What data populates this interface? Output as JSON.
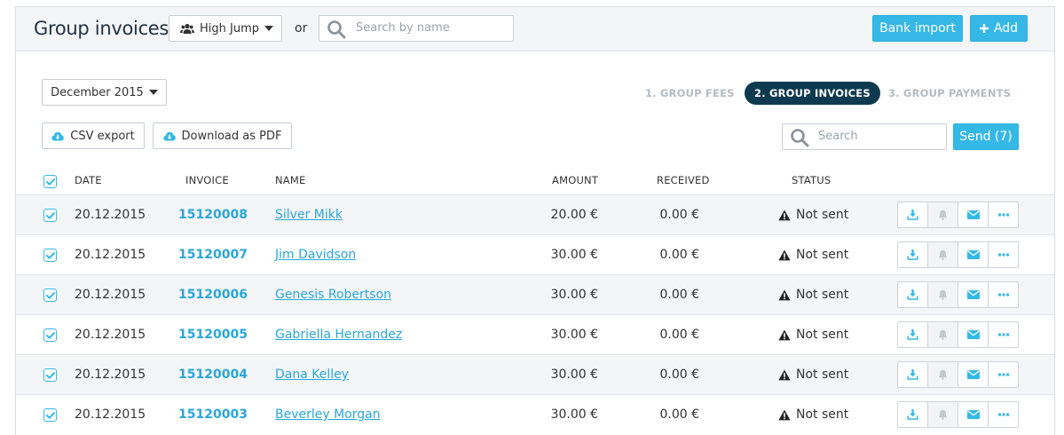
{
  "header": {
    "title": "Group invoices",
    "group_selector": "High Jump",
    "or_text": "or",
    "search_placeholder": "Search by name",
    "bank_import_label": "Bank import",
    "add_label": "Add"
  },
  "toolbar": {
    "month": "December 2015",
    "steps": [
      {
        "label": "1. GROUP FEES",
        "active": false
      },
      {
        "label": "2. GROUP INVOICES",
        "active": true
      },
      {
        "label": "3. GROUP PAYMENTS",
        "active": false
      }
    ],
    "csv_export_label": "CSV export",
    "pdf_label": "Download as PDF",
    "search_placeholder": "Search",
    "send_label": "Send (7)"
  },
  "table": {
    "columns": {
      "date": "DATE",
      "invoice": "INVOICE",
      "name": "NAME",
      "amount": "AMOUNT",
      "received": "RECEIVED",
      "status": "STATUS"
    },
    "rows": [
      {
        "date": "20.12.2015",
        "invoice": "15120008",
        "name": "Silver Mikk",
        "amount": "20.00 €",
        "received": "0.00 €",
        "status": "Not sent"
      },
      {
        "date": "20.12.2015",
        "invoice": "15120007",
        "name": "Jim Davidson",
        "amount": "30.00 €",
        "received": "0.00 €",
        "status": "Not sent"
      },
      {
        "date": "20.12.2015",
        "invoice": "15120006",
        "name": "Genesis Robertson",
        "amount": "30.00 €",
        "received": "0.00 €",
        "status": "Not sent"
      },
      {
        "date": "20.12.2015",
        "invoice": "15120005",
        "name": "Gabriella Hernandez",
        "amount": "30.00 €",
        "received": "0.00 €",
        "status": "Not sent"
      },
      {
        "date": "20.12.2015",
        "invoice": "15120004",
        "name": "Dana Kelley",
        "amount": "30.00 €",
        "received": "0.00 €",
        "status": "Not sent"
      },
      {
        "date": "20.12.2015",
        "invoice": "15120003",
        "name": "Beverley Morgan",
        "amount": "30.00 €",
        "received": "0.00 €",
        "status": "Not sent"
      }
    ]
  },
  "colors": {
    "accent": "#35b8e6",
    "link": "#2aa6d8",
    "active_step": "#0e3a4f",
    "muted_step": "#b4bbc3"
  },
  "icons": {
    "group": "users-icon",
    "dropdown": "caret-down-icon",
    "search": "magnifier-icon",
    "add": "plus-icon",
    "export": "cloud-download-icon",
    "download": "download-icon",
    "reminder": "bell-icon",
    "email": "envelope-icon",
    "more": "ellipsis-icon",
    "warning": "warning-triangle-icon",
    "check": "checkbox-checked-icon"
  }
}
